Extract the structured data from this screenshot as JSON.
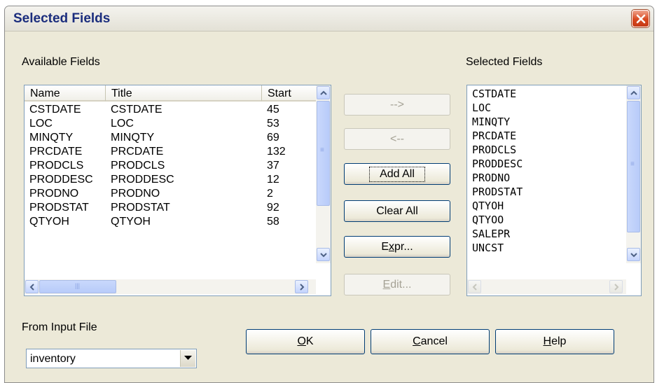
{
  "window": {
    "title": "Selected Fields",
    "close_icon": "close-icon"
  },
  "available": {
    "label": "Available Fields",
    "columns": [
      "Name",
      "Title",
      "Start"
    ],
    "rows": [
      {
        "name": "CSTDATE",
        "title": "CSTDATE",
        "start": "45"
      },
      {
        "name": "LOC",
        "title": "LOC",
        "start": "53"
      },
      {
        "name": "MINQTY",
        "title": "MINQTY",
        "start": "69"
      },
      {
        "name": "PRCDATE",
        "title": "PRCDATE",
        "start": "132"
      },
      {
        "name": "PRODCLS",
        "title": "PRODCLS",
        "start": "37"
      },
      {
        "name": "PRODDESC",
        "title": "PRODDESC",
        "start": "12"
      },
      {
        "name": "PRODNO",
        "title": "PRODNO",
        "start": "2"
      },
      {
        "name": "PRODSTAT",
        "title": "PRODSTAT",
        "start": "92"
      },
      {
        "name": "QTYOH",
        "title": "QTYOH",
        "start": "58"
      }
    ]
  },
  "buttons": {
    "add": "-->",
    "remove": "<--",
    "add_all": "Add All",
    "clear_all": "Clear All",
    "expr_pre": "E",
    "expr_mnemonic": "x",
    "expr_post": "pr...",
    "edit_mnemonic": "E",
    "edit_post": "dit...",
    "ok_mnemonic": "O",
    "ok_post": "K",
    "cancel_mnemonic": "C",
    "cancel_post": "ancel",
    "help_mnemonic": "H",
    "help_post": "elp"
  },
  "selected": {
    "label": "Selected Fields",
    "items": [
      "CSTDATE",
      "LOC",
      "MINQTY",
      "PRCDATE",
      "PRODCLS",
      "PRODDESC",
      "PRODNO",
      "PRODSTAT",
      "QTYOH",
      "QTYOO",
      "SALEPR",
      "UNCST"
    ]
  },
  "input_file": {
    "label": "From Input File",
    "value": "inventory"
  }
}
